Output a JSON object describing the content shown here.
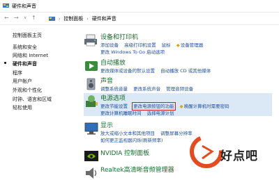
{
  "window": {
    "title": "硬件和声音"
  },
  "address": {
    "back": "←",
    "forward": "→",
    "up": "↑",
    "crumbs": [
      "控制面板",
      "硬件和声音"
    ]
  },
  "sidebar": {
    "items": [
      {
        "label": "控制面板主页",
        "active": false
      },
      {
        "label": "系统和安全",
        "active": false
      },
      {
        "label": "网络和 Internet",
        "active": false
      },
      {
        "label": "硬件和声音",
        "active": true
      },
      {
        "label": "程序",
        "active": false
      },
      {
        "label": "用户帐户",
        "active": false
      },
      {
        "label": "外观和个性化",
        "active": false
      },
      {
        "label": "时钟、语言和区域",
        "active": false
      },
      {
        "label": "轻松使用",
        "active": false
      }
    ]
  },
  "categories": {
    "devices": {
      "title": "设备和打印机",
      "row1": [
        "添加设备",
        "高级打印机设置",
        "鼠标",
        "设备管理器"
      ],
      "row2": [
        "更改 Windows To Go 启动选项"
      ]
    },
    "autoplay": {
      "title": "自动播放",
      "row1": [
        "更改媒体或设备的默认设置",
        "自动播放 CD 或其他媒体"
      ]
    },
    "sound": {
      "title": "声音",
      "row1": [
        "调整系统音量",
        "更改系统声音",
        "管理音频设备"
      ]
    },
    "power": {
      "title": "电源选项",
      "row1": [
        "更改节能设置",
        "更改电源按钮的功能",
        "唤醒计算机时需要密码"
      ],
      "row2": [
        "更改计算机睡眠时间",
        "选择电源计划"
      ]
    },
    "display": {
      "title": "显示",
      "row1": [
        "放大或缩小文本和其他项目",
        "调整屏幕分辨率"
      ],
      "row2": [
        "如何更正监视器闪烁(刷新频率)"
      ]
    },
    "nvidia": {
      "title": "NVIDIA 控制面板"
    },
    "realtek": {
      "title": "Realtek高清晰音频管理器"
    }
  },
  "watermark": {
    "text": "好点吧"
  },
  "colors": {
    "link": "#1f4f9e",
    "category": "#1e6b2e",
    "highlight": "#d11b1b",
    "power_bg": "#dbe9f7"
  }
}
